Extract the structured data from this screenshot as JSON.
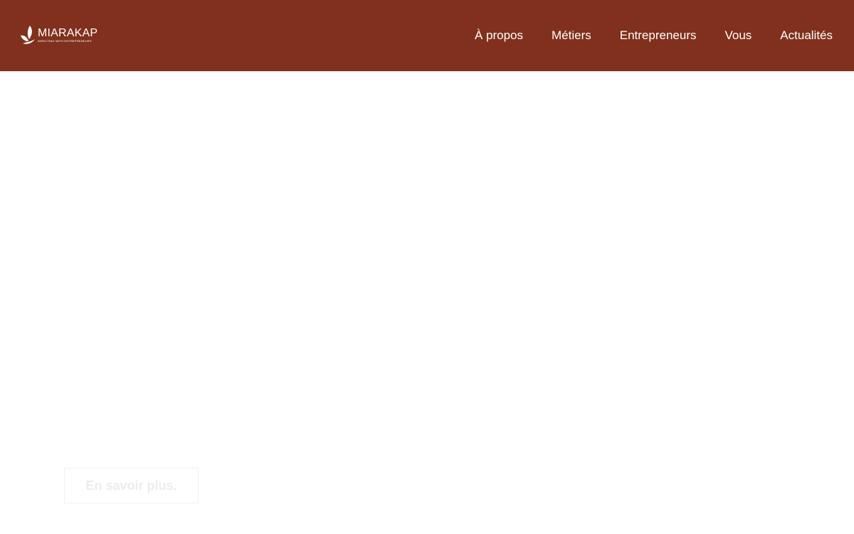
{
  "header": {
    "logo": {
      "name": "MIARAKAP",
      "tagline": "IMPACTING WITH ENTREPRENEURS",
      "icon": "leaf-icon"
    },
    "nav": [
      {
        "label": "À propos"
      },
      {
        "label": "Métiers"
      },
      {
        "label": "Entrepreneurs"
      },
      {
        "label": "Vous"
      },
      {
        "label": "Actualités"
      }
    ]
  },
  "hero": {
    "cta_label": "En savoir plus."
  },
  "colors": {
    "header_bg": "#80301c",
    "nav_text": "#ffffff",
    "cta_text": "#ececec",
    "cta_border": "#f1f1f1"
  }
}
